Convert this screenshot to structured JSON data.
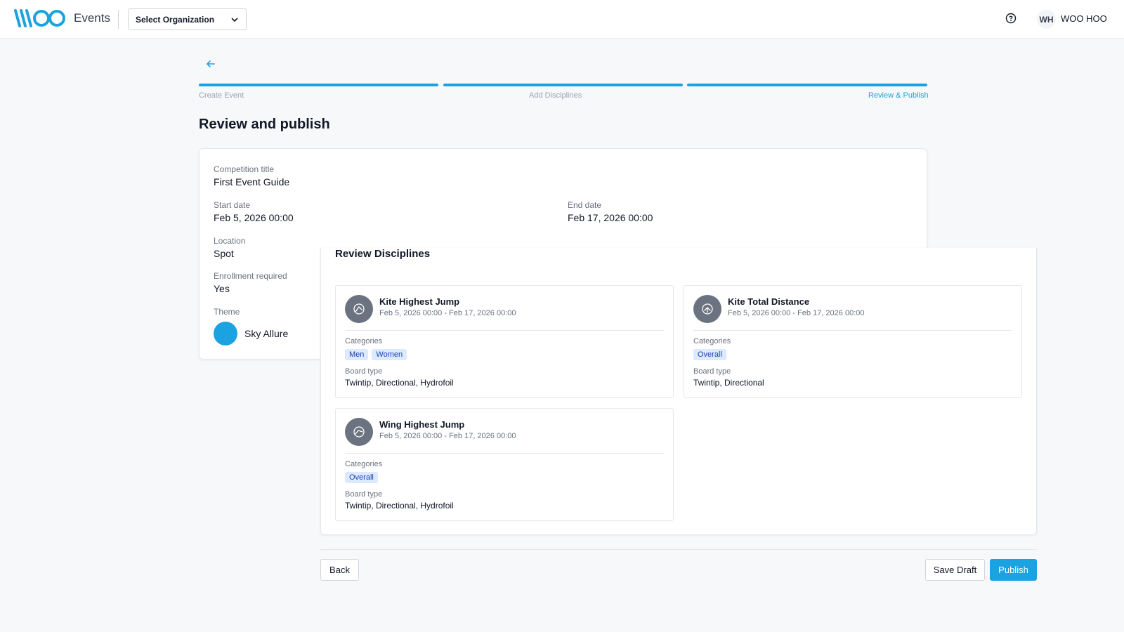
{
  "header": {
    "app_name": "Events",
    "org_select_label": "Select Organization",
    "user_initials": "WH",
    "user_name": "WOO HOO"
  },
  "stepper": {
    "steps": [
      {
        "label": "Create Event",
        "state": "done"
      },
      {
        "label": "Add Disciplines",
        "state": "done"
      },
      {
        "label": "Review & Publish",
        "state": "current"
      }
    ],
    "accent_color": "#1aa3e0"
  },
  "page": {
    "title": "Review and publish"
  },
  "summary": {
    "competition_title_label": "Competition title",
    "competition_title": "First Event Guide",
    "start_date_label": "Start date",
    "start_date": "Feb 5, 2026 00:00",
    "end_date_label": "End date",
    "end_date": "Feb 17, 2026 00:00",
    "location_label": "Location",
    "location": "Spot",
    "enrollment_label": "Enrollment required",
    "enrollment": "Yes",
    "theme_label": "Theme",
    "theme_name": "Sky Allure",
    "theme_color": "#1aa3e0"
  },
  "disciplines": {
    "title": "Review Disciplines",
    "categories_label": "Categories",
    "board_type_label": "Board type",
    "items": [
      {
        "name": "Kite Highest Jump",
        "dates": "Feb 5, 2026 00:00 - Feb 17, 2026 00:00",
        "categories": [
          "Men",
          "Women"
        ],
        "board_type": "Twintip, Directional, Hydrofoil",
        "icon": "kite-jump-icon"
      },
      {
        "name": "Kite Total Distance",
        "dates": "Feb 5, 2026 00:00 - Feb 17, 2026 00:00",
        "categories": [
          "Overall"
        ],
        "board_type": "Twintip, Directional",
        "icon": "kite-distance-icon"
      },
      {
        "name": "Wing Highest Jump",
        "dates": "Feb 5, 2026 00:00 - Feb 17, 2026 00:00",
        "categories": [
          "Overall"
        ],
        "board_type": "Twintip, Directional, Hydrofoil",
        "icon": "wing-jump-icon"
      }
    ]
  },
  "footer": {
    "back_label": "Back",
    "save_draft_label": "Save Draft",
    "publish_label": "Publish"
  }
}
